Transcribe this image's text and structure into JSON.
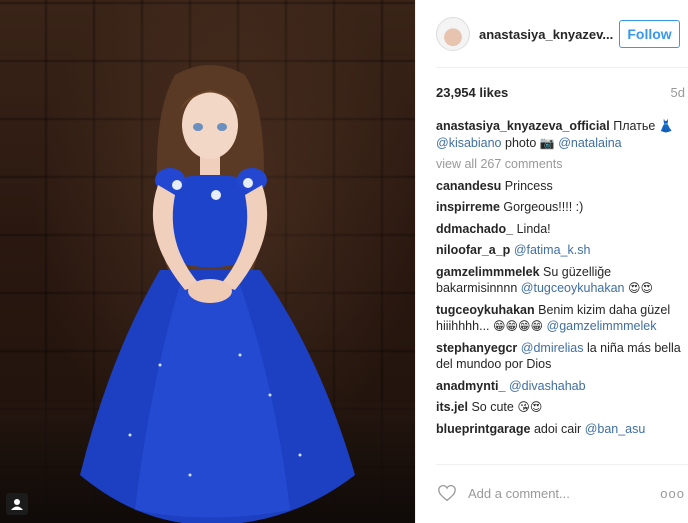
{
  "post": {
    "username": "anastasiya_knyazev...",
    "follow_label": "Follow",
    "likes": "23,954 likes",
    "age": "5d",
    "caption": {
      "user": "anastasiya_knyazeva_official",
      "text": "Платье",
      "emoji": "👗",
      "mention1": "@kisabiano",
      "photo_word": "photo",
      "camera_emoji": "📷",
      "mention2": "@natalaina"
    },
    "view_all": "view all 267 comments"
  },
  "comments": [
    {
      "user": "canandesu",
      "text": "Princess"
    },
    {
      "user": "inspirreme",
      "text": "Gorgeous!!!! :)"
    },
    {
      "user": "ddmachado_",
      "text": "Linda!"
    },
    {
      "user": "niloofar_a_p",
      "text": "",
      "mention": "@fatima_k.sh"
    },
    {
      "user": "gamzelimmmelek",
      "text": "Su güzelliğe bakarmisinnnn",
      "mention": "@tugceoykuhakan",
      "emoji": "😍😍"
    },
    {
      "user": "tugceoykuhakan",
      "text": "Benim kizim daha güzel hiiihhhh...",
      "emoji": "😁😁😁😁",
      "mention": "@gamzelimmmelek"
    },
    {
      "user": "stephanyegcr",
      "mention": "@dmirelias",
      "text": "la niña más bella del mundoo por Dios"
    },
    {
      "user": "anadmynti_",
      "text": "",
      "mention": "@divashahab"
    },
    {
      "user": "its.jel",
      "text": "So cute",
      "emoji": "😘😍"
    },
    {
      "user": "blueprintgarage",
      "text": "adoi cair",
      "mention": "@ban_asu"
    }
  ],
  "footer": {
    "add_comment_placeholder": "Add a comment...",
    "more_label": "ooo"
  },
  "icons": {
    "heart": "heart-icon",
    "camera": "camera-icon",
    "more": "more-options-icon"
  },
  "colors": {
    "accent": "#3897f0",
    "mention": "#3f6ea4",
    "dress": "#1d3fc2"
  }
}
